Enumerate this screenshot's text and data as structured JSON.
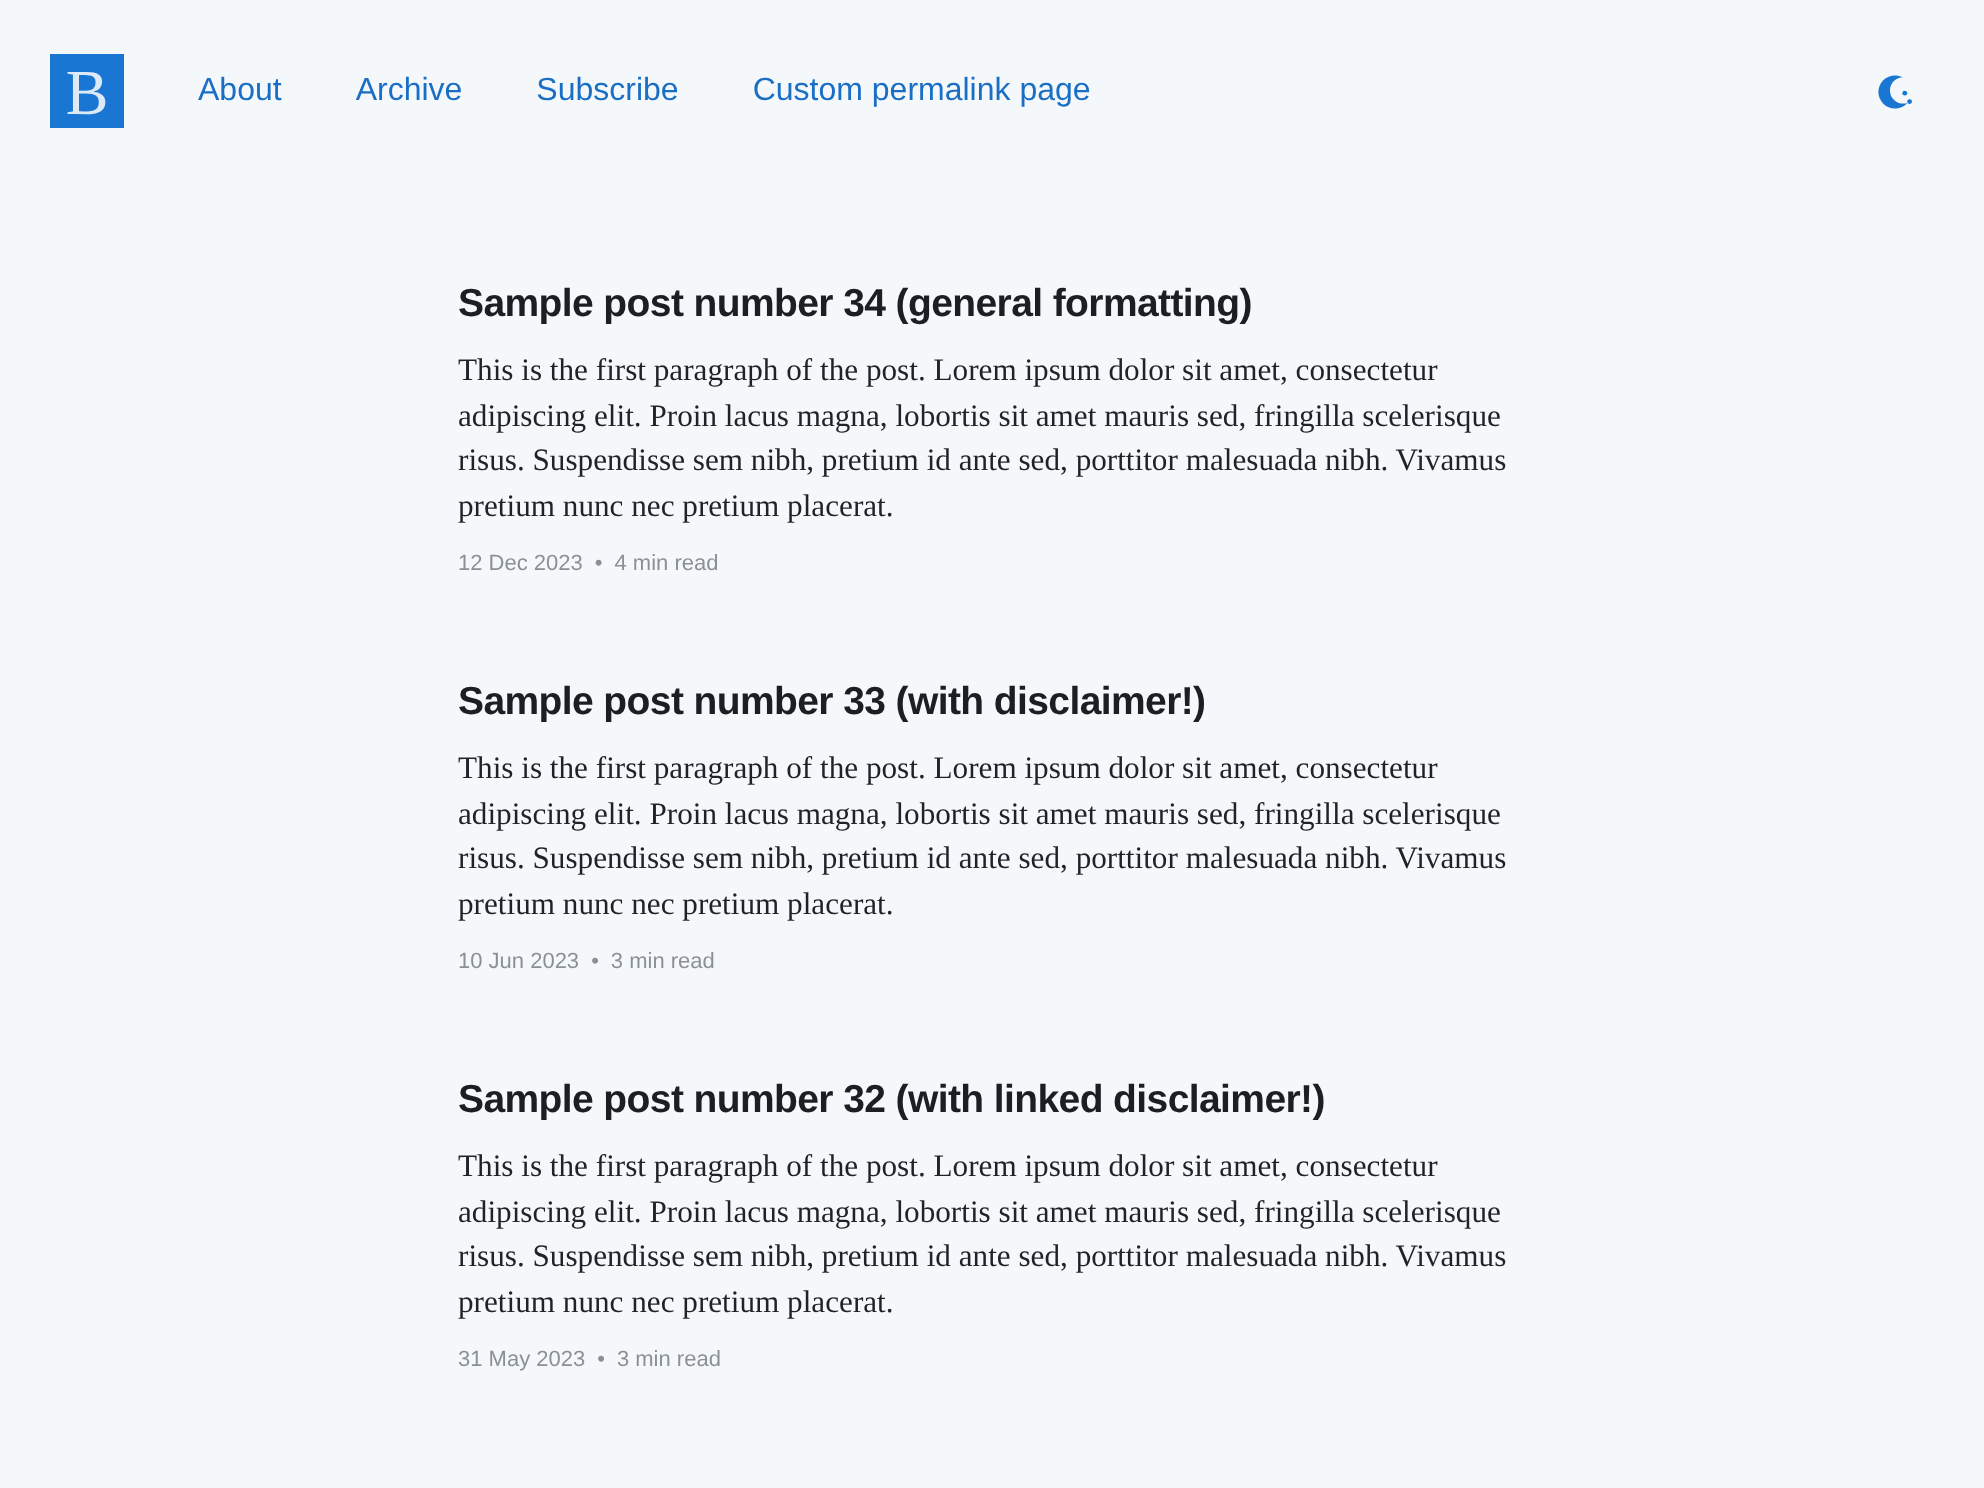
{
  "site": {
    "logo": "B"
  },
  "nav": [
    {
      "label": "About"
    },
    {
      "label": "Archive"
    },
    {
      "label": "Subscribe"
    },
    {
      "label": "Custom permalink page"
    }
  ],
  "posts": [
    {
      "title": "Sample post number 34 (general formatting)",
      "excerpt": "This is the first paragraph of the post. Lorem ipsum dolor sit amet, consectetur adipiscing elit. Proin lacus magna, lobortis sit amet mauris sed, fringilla scelerisque risus. Suspendisse sem nibh, pretium id ante sed, porttitor malesuada nibh. Vivamus pretium nunc nec pretium placerat.",
      "date": "12 Dec 2023",
      "separator": "•",
      "read_time": "4 min read"
    },
    {
      "title": "Sample post number 33 (with disclaimer!)",
      "excerpt": "This is the first paragraph of the post. Lorem ipsum dolor sit amet, consectetur adipiscing elit. Proin lacus magna, lobortis sit amet mauris sed, fringilla scelerisque risus. Suspendisse sem nibh, pretium id ante sed, porttitor malesuada nibh. Vivamus pretium nunc nec pretium placerat.",
      "date": "10 Jun 2023",
      "separator": "•",
      "read_time": "3 min read"
    },
    {
      "title": "Sample post number 32 (with linked disclaimer!)",
      "excerpt": "This is the first paragraph of the post. Lorem ipsum dolor sit amet, consectetur adipiscing elit. Proin lacus magna, lobortis sit amet mauris sed, fringilla scelerisque risus. Suspendisse sem nibh, pretium id ante sed, porttitor malesuada nibh. Vivamus pretium nunc nec pretium placerat.",
      "date": "31 May 2023",
      "separator": "•",
      "read_time": "3 min read"
    }
  ]
}
